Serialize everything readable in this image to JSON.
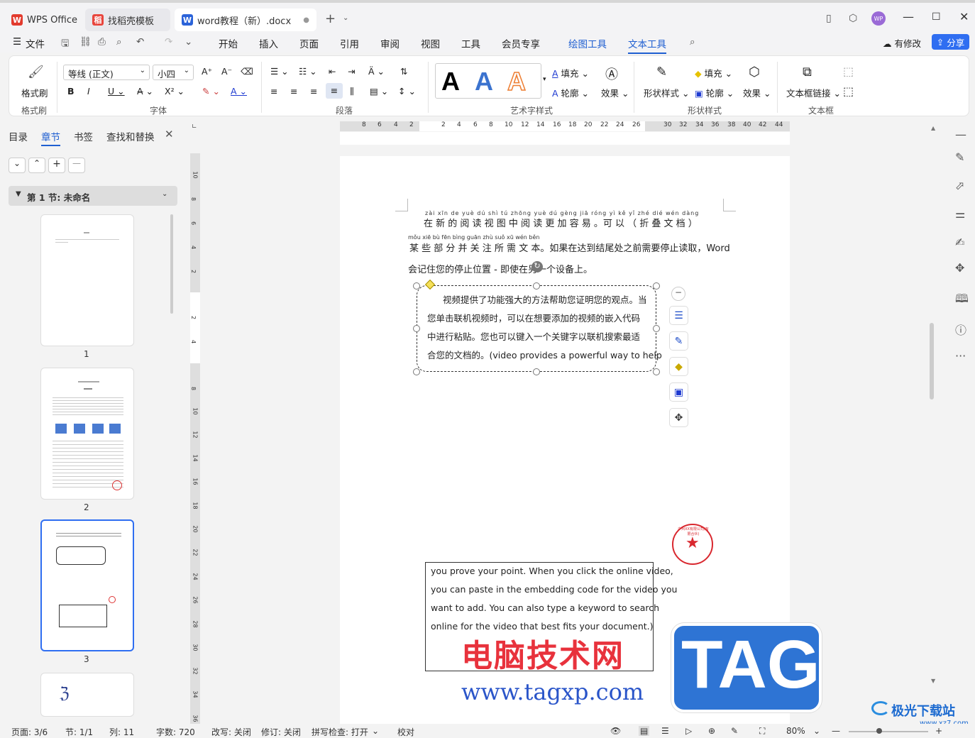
{
  "tabs": [
    {
      "label": "WPS Office",
      "icon": "wps-logo-icon"
    },
    {
      "label": "找稻壳模板",
      "icon": "docer-icon"
    },
    {
      "label": "word教程（新）.docx",
      "icon": "word-doc-icon"
    }
  ],
  "window": {
    "avatar": "WP"
  },
  "menu": {
    "file": "文件",
    "items": [
      "开始",
      "插入",
      "页面",
      "引用",
      "审阅",
      "视图",
      "工具",
      "会员专享"
    ],
    "context_tabs": [
      "绘图工具",
      "文本工具"
    ],
    "modified": "有修改",
    "share": "分享"
  },
  "ribbon": {
    "format_painter": "格式刷",
    "font_name": "等线 (正文)",
    "font_size": "小四",
    "groups": [
      "格式刷",
      "字体",
      "段落",
      "艺术字样式",
      "形状样式",
      "文本框"
    ],
    "art_fill": "填充",
    "art_outline": "轮廓",
    "art_effect": "效果",
    "shape_style": "形状样式",
    "shape_fill": "填充",
    "shape_outline": "轮廓",
    "shape_effect": "效果",
    "textbox_link": "文本框链接",
    "art_letters": [
      "A",
      "A",
      "A"
    ]
  },
  "left_panel": {
    "tabs": [
      "目录",
      "章节",
      "书签",
      "查找和替换"
    ],
    "section": "第 1 节: 未命名",
    "pages": [
      "1",
      "2",
      "3"
    ]
  },
  "rulers": {
    "h_ticks": [
      "8",
      "6",
      "4",
      "2",
      "2",
      "4",
      "6",
      "8",
      "10",
      "12",
      "14",
      "16",
      "18",
      "20",
      "22",
      "24",
      "26",
      "30",
      "32",
      "34",
      "36",
      "38",
      "40",
      "42",
      "44"
    ],
    "v_ticks": [
      "10",
      "8",
      "6",
      "4",
      "2",
      "2",
      "4",
      "8",
      "10",
      "12",
      "14",
      "16",
      "18",
      "20",
      "22",
      "24",
      "26",
      "28",
      "30",
      "32",
      "34",
      "36"
    ]
  },
  "document": {
    "pinyin1": "zài xīn de yuè dú shì tú zhōng yuè dú gèng jiā róng yì  kě yǐ  zhé dié wén dàng",
    "line1": "在 新 的 阅 读 视 图 中 阅 读 更 加 容 易 。可 以 （ 折 叠 文 档 ）",
    "pinyin2": "mǒu xiē bù fēn bìng guān zhù suǒ xū wén běn",
    "line2": "某 些 部 分 并 关 注 所 需 文 本。如果在达到结尾处之前需要停止读取，Word",
    "line3": "会记住您的停止位置 - 即使在另一个设备上。",
    "textbox1": [
      "视频提供了功能强大的方法帮助您证明您的观点。当",
      "您单击联机视频时，可以在想要添加的视频的嵌入代码",
      "中进行粘贴。您也可以键入一个关键字以联机搜索最适",
      "合您的文档的。(video provides a powerful way to help"
    ],
    "textbox2": [
      "you prove your point. When you click the online video,",
      "you can paste in the embedding code for the video you",
      "want to add. You can also type a keyword to search",
      "online for the video that best fits your document.)"
    ],
    "stamp_text": "广州XX有限公司(有限合伙)"
  },
  "watermark": {
    "title": "电脑技术网",
    "url": "www.tagxp.com",
    "badge": "TAG",
    "site": "极光下载站",
    "site_url": "www.xz7.com"
  },
  "status": {
    "page": "页面: 3/6",
    "section": "节: 1/1",
    "column": "列: 11",
    "words": "字数: 720",
    "overtype": "改写: 关闭",
    "revision": "修订: 关闭",
    "spell": "拼写检查: 打开",
    "proof": "校对",
    "zoom": "80%"
  },
  "colors": {
    "accent": "#1f5fd1",
    "red": "#d9282f",
    "share": "#2f6ef1"
  }
}
